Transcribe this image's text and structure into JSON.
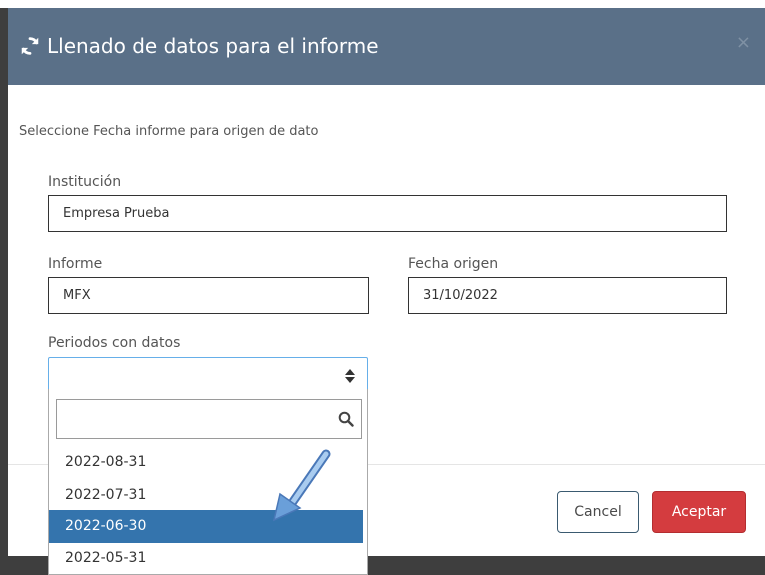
{
  "modal": {
    "title": "Llenado de datos para el informe",
    "close_label": "×",
    "subtitle": "Seleccione Fecha informe para origen de dato"
  },
  "fields": {
    "institucion": {
      "label": "Institución",
      "value": "Empresa Prueba"
    },
    "informe": {
      "label": "Informe",
      "value": "MFX"
    },
    "fecha_origen": {
      "label": "Fecha origen",
      "value": "31/10/2022"
    },
    "periodos": {
      "label": "Periodos con datos",
      "selected": ""
    }
  },
  "dropdown": {
    "search_value": "",
    "options": [
      "2022-08-31",
      "2022-07-31",
      "2022-06-30",
      "2022-05-31"
    ],
    "highlighted": "2022-06-30"
  },
  "buttons": {
    "cancel": "Cancel",
    "accept": "Aceptar"
  },
  "colors": {
    "header_bg": "#5a7088",
    "selected_option_bg": "#3474ad",
    "accept_bg": "#d43c3f",
    "annotation_arrow": "#6a9fd9"
  },
  "icons": {
    "title_icon": "refresh-icon",
    "select_icon": "sort-arrows-icon",
    "search_icon": "search-icon"
  }
}
